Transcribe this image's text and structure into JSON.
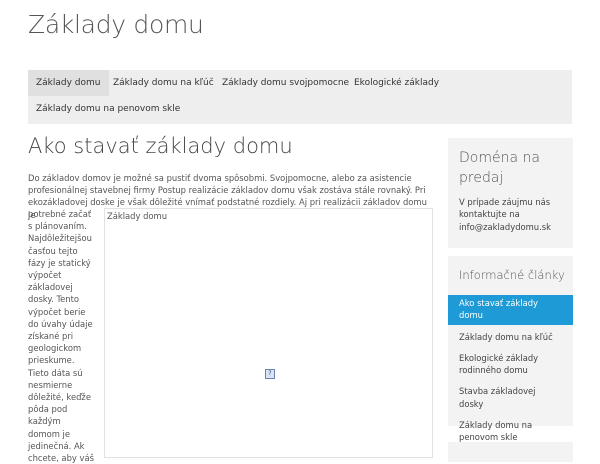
{
  "site": {
    "title": "Základy domu"
  },
  "nav": {
    "items": [
      "Základy domu",
      "Základy domu na kľúč",
      "Základy domu svojpomocne",
      "Ekologické základy",
      "Základy domu na penovom skle"
    ]
  },
  "article": {
    "title": "Ako stavať základy domu",
    "intro": "Do základov domov je možné sa pustiť dvoma spôsobmi. Svojpomocne, alebo za asistencie profesionálnej stavebnej firmy Postup realizácie základov domu však zostáva stále rovnaký. Pri ekozákladovej doske je však dôležité vnímať podstatné rozdiely. Aj pri realizácii základov domu je",
    "side_lines": [
      "potrebné začať",
      "s plánovaním.",
      "Najdôležitejšou",
      "časťou tejto",
      "fázy je statický",
      "výpočet",
      "základovej",
      "dosky. Tento",
      "výpočet berie",
      "do úvahy údaje",
      "získané pri",
      "geologickom",
      "prieskume.",
      "Tieto dáta sú",
      "nesmierne",
      "dôležité, keďže",
      "pôda pod",
      "každým",
      "domom je",
      "jedinečná. Ak",
      "chcete, aby váš"
    ],
    "figure_caption": "Základy domu",
    "broken_image_glyph": "?"
  },
  "sidebar": {
    "widget1": {
      "title": "Doména na predaj",
      "text": "V prípade záujmu nás kontaktujte na info@zakladydomu.sk"
    },
    "widget2": {
      "title": "Informačné články",
      "links": [
        "Ako stavať základy domu",
        "Základy domu na kľúč",
        "Ekologické základy rodinného domu",
        "Stavba základovej dosky",
        "Základy domu na penovom skle"
      ]
    }
  }
}
